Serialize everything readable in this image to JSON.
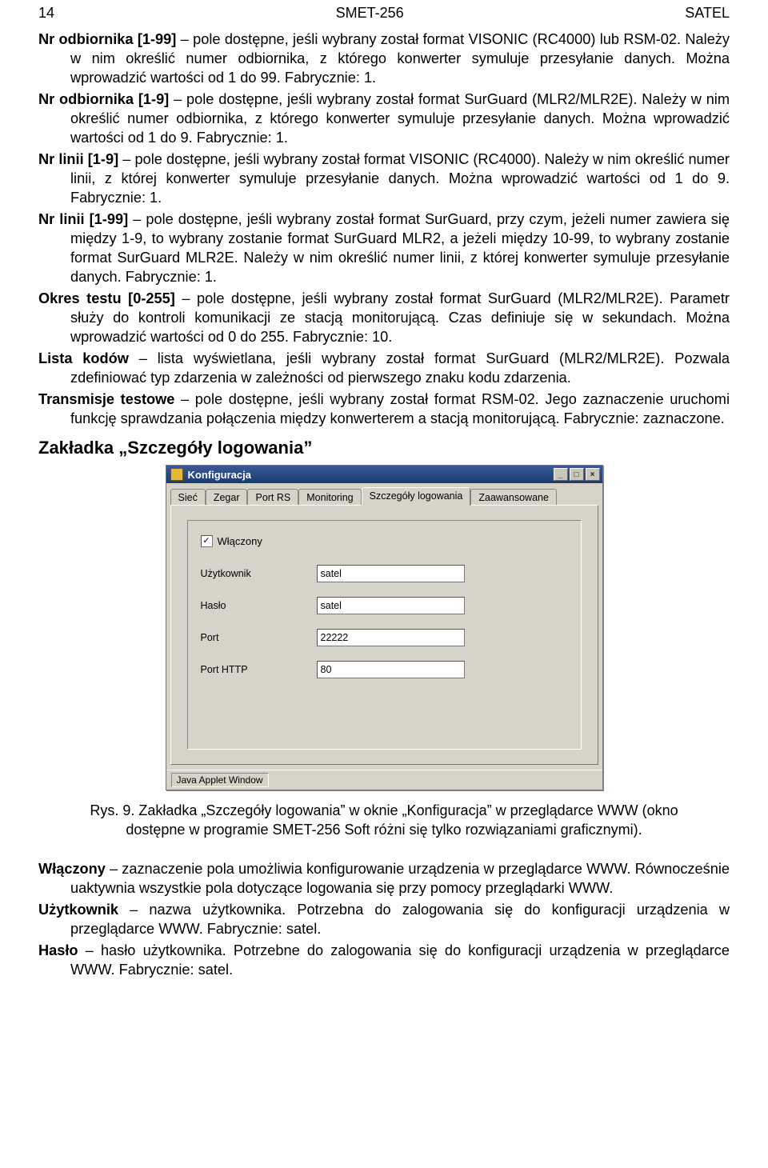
{
  "header": {
    "page_no": "14",
    "title": "SMET-256",
    "brand": "SATEL"
  },
  "paras": {
    "p1_b": "Nr odbiornika [1-99]",
    "p1": " – pole dostępne, jeśli wybrany został format VISONIC (RC4000) lub RSM-02. Należy w nim określić numer odbiornika, z którego konwerter symuluje przesyłanie danych. Można wprowadzić wartości od 1 do 99. Fabrycznie: 1.",
    "p2_b": "Nr odbiornika [1-9]",
    "p2": " – pole dostępne, jeśli wybrany został format SurGuard (MLR2/MLR2E). Należy w nim określić numer odbiornika, z którego konwerter symuluje przesyłanie danych. Można wprowadzić wartości od 1 do 9. Fabrycznie: 1.",
    "p3_b": "Nr linii [1-9]",
    "p3": " – pole dostępne, jeśli wybrany został format VISONIC (RC4000). Należy w nim określić numer linii, z której konwerter symuluje przesyłanie danych. Można wprowadzić wartości od 1 do 9. Fabrycznie: 1.",
    "p4_b": "Nr linii [1-99]",
    "p4": " – pole dostępne, jeśli wybrany został format SurGuard, przy czym, jeżeli numer zawiera się między 1-9, to wybrany zostanie format SurGuard MLR2, a jeżeli między 10-99, to wybrany zostanie format SurGuard MLR2E. Należy w nim określić numer linii, z której konwerter symuluje przesyłanie danych. Fabrycznie: 1.",
    "p5_b": "Okres testu [0-255]",
    "p5": " – pole dostępne, jeśli wybrany został format SurGuard (MLR2/MLR2E). Parametr służy do kontroli komunikacji ze stacją monitorującą. Czas definiuje się w sekundach. Można wprowadzić wartości od 0 do 255. Fabrycznie: 10.",
    "p6_b": "Lista kodów",
    "p6": " – lista wyświetlana, jeśli wybrany został format SurGuard (MLR2/MLR2E). Pozwala zdefiniować typ zdarzenia w zależności od pierwszego znaku kodu zdarzenia.",
    "p7_b": "Transmisje testowe",
    "p7": " – pole dostępne, jeśli wybrany został format RSM-02. Jego zaznaczenie uruchomi funkcję sprawdzania połączenia między konwerterem a stacją monitorującą. Fabrycznie: zaznaczone.",
    "section_title": "Zakładka „Szczegóły logowania”",
    "caption": "Rys. 9. Zakładka „Szczegóły logowania” w oknie „Konfiguracja” w przeglądarce WWW (okno dostępne w programie SMET-256 Soft różni się tylko rozwiązaniami graficznymi).",
    "p8_b": "Włączony",
    "p8": " – zaznaczenie pola umożliwia konfigurowanie urządzenia w przeglądarce WWW. Równocześnie uaktywnia wszystkie pola dotyczące logowania się przy pomocy przeglądarki WWW.",
    "p9_b": "Użytkownik",
    "p9": " – nazwa użytkownika. Potrzebna do zalogowania się do konfiguracji urządzenia w przeglądarce WWW. Fabrycznie: satel.",
    "p10_b": "Hasło",
    "p10": " – hasło użytkownika. Potrzebne do zalogowania się do konfiguracji urządzenia w przeglądarce WWW. Fabrycznie: satel."
  },
  "win": {
    "title": "Konfiguracja",
    "min": "_",
    "max": "□",
    "close": "×",
    "tabs": [
      "Sieć",
      "Zegar",
      "Port RS",
      "Monitoring",
      "Szczegóły logowania",
      "Zaawansowane"
    ],
    "enabled_label": "Włączony",
    "check_mark": "✓",
    "user_label": "Użytkownik",
    "user_value": "satel",
    "pass_label": "Hasło",
    "pass_value": "satel",
    "port_label": "Port",
    "port_value": "22222",
    "http_label": "Port HTTP",
    "http_value": "80",
    "status": "Java Applet Window"
  }
}
